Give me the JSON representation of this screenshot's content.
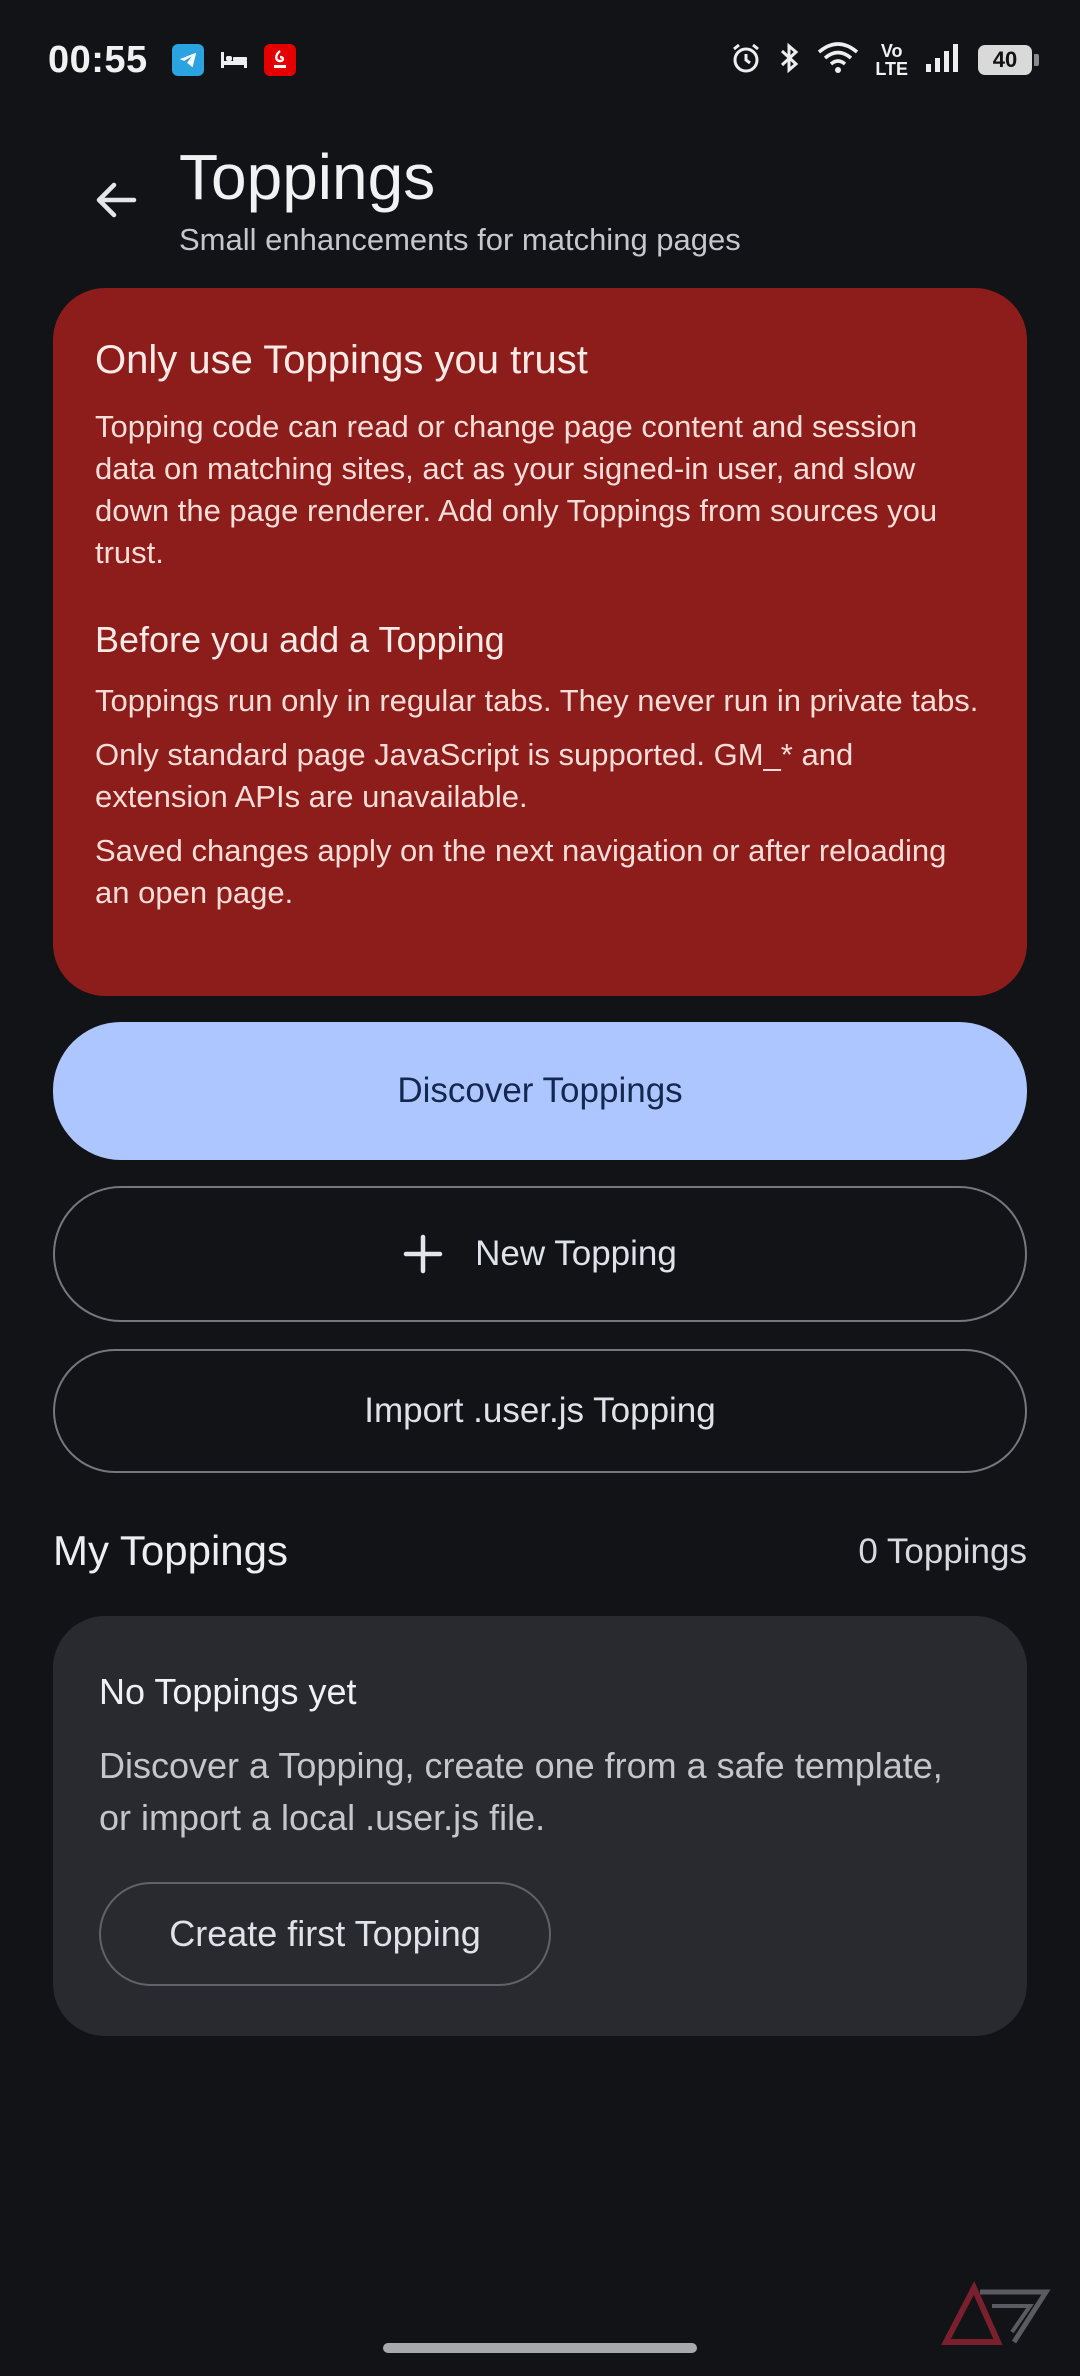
{
  "status_bar": {
    "time": "00:55",
    "volte_top": "Vo",
    "volte_bottom": "LTE",
    "battery": "40",
    "icons": [
      "telegram-icon",
      "bed-icon",
      "airtel-icon",
      "alarm-icon",
      "bluetooth-icon",
      "wifi-icon",
      "signal-icon",
      "battery-icon"
    ]
  },
  "header": {
    "title": "Toppings",
    "subtitle": "Small enhancements for matching pages"
  },
  "warning": {
    "title": "Only use Toppings you trust",
    "body": "Topping code can read or change page content and session data on matching sites, act as your signed-in user, and slow down the page renderer. Add only Toppings from sources you trust.",
    "subtitle": "Before you add a Topping",
    "items": [
      "Toppings run only in regular tabs. They never run in private tabs.",
      "Only standard page JavaScript is supported. GM_* and extension APIs are unavailable.",
      "Saved changes apply on the next navigation or after reloading an open page."
    ]
  },
  "actions": {
    "discover": "Discover Toppings",
    "new": "New Topping",
    "import": "Import .user.js Topping"
  },
  "my_toppings": {
    "title": "My Toppings",
    "count": "0 Toppings",
    "empty_title": "No Toppings yet",
    "empty_body": "Discover a Topping, create one from a safe template, or import a local .user.js file.",
    "create_first": "Create first Topping"
  },
  "colors": {
    "background": "#111317",
    "warning_bg": "#8c1d1b",
    "primary_button": "#aec6ff",
    "card_bg": "#292a2f"
  }
}
